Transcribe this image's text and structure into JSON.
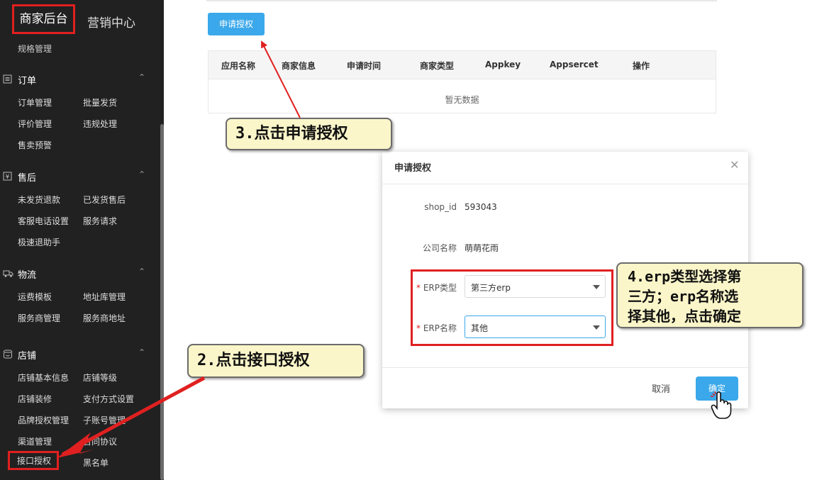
{
  "sidebar": {
    "tabs": {
      "main": "商家后台",
      "marketing": "营销中心"
    },
    "spec_item": "规格管理",
    "groups": {
      "order": {
        "title": "订单",
        "items": [
          "订单管理",
          "批量发货",
          "评价管理",
          "违规处理",
          "售卖预警"
        ]
      },
      "aftersale": {
        "title": "售后",
        "items": [
          "未发货退款",
          "已发货售后",
          "客服电话设置",
          "服务请求",
          "极速退助手"
        ]
      },
      "logistics": {
        "title": "物流",
        "items": [
          "运费模板",
          "地址库管理",
          "服务商管理",
          "服务商地址"
        ]
      },
      "shop": {
        "title": "店铺",
        "items": [
          "店铺基本信息",
          "店铺等级",
          "店铺装修",
          "支付方式设置",
          "品牌授权管理",
          "子账号管理",
          "渠道管理",
          "合同协议",
          "接口授权",
          "黑名单"
        ]
      }
    },
    "icons": {
      "order": "list-icon",
      "aftersale": "yen-icon",
      "logistics": "truck-icon",
      "shop": "store-icon",
      "caret": "chevron-up-icon"
    }
  },
  "main": {
    "apply_button": "申请授权",
    "table": {
      "columns": [
        "应用名称",
        "商家信息",
        "申请时间",
        "商家类型",
        "Appkey",
        "Appsercet",
        "操作"
      ],
      "empty_text": "暂无数据"
    }
  },
  "dialog": {
    "title": "申请授权",
    "close_icon": "close-icon",
    "fields": {
      "shop_id": {
        "label": "shop_id",
        "value": "593043"
      },
      "company": {
        "label": "公司名称",
        "value": "萌萌花雨"
      },
      "erp_type": {
        "required_mark": "*",
        "label": "ERP类型",
        "value": "第三方erp"
      },
      "erp_name": {
        "required_mark": "*",
        "label": "ERP名称",
        "value": "其他"
      }
    },
    "cancel": "取消",
    "confirm": "确定"
  },
  "callouts": {
    "step2": "2.点击接口授权",
    "step3": "3.点击申请授权",
    "step4_line1": "4.erp类型选择第",
    "step4_line2": "三方；erp名称选",
    "step4_line3": "择其他，点击确定"
  },
  "colors": {
    "sidebar_bg": "#212121",
    "accent_blue": "#3aa8ea",
    "highlight_red": "#e02020",
    "callout_bg": "#fbf6c9"
  }
}
